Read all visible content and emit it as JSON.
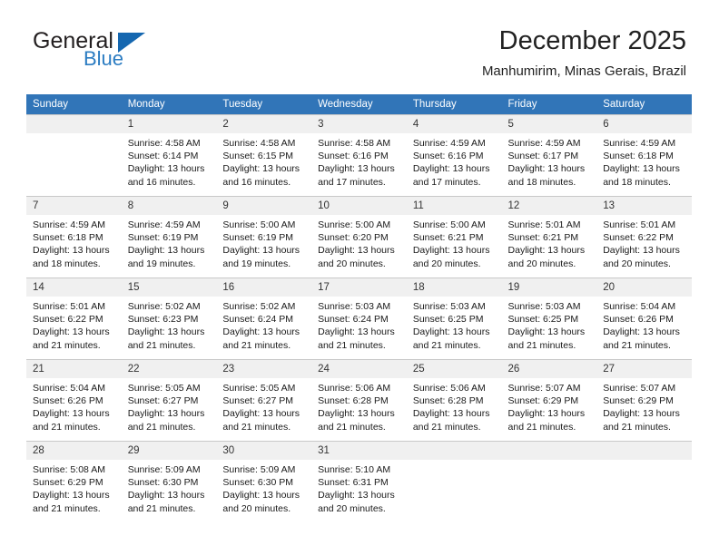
{
  "brand": {
    "name_part1": "General",
    "name_part2": "Blue",
    "triangle_color": "#1567b0",
    "blue_text_color": "#2b7cc2"
  },
  "header": {
    "title": "December 2025",
    "location": "Manhumirim, Minas Gerais, Brazil"
  },
  "calendar": {
    "header_bg": "#3175b8",
    "daynum_bg": "#f0f0f0",
    "weekdays": [
      "Sunday",
      "Monday",
      "Tuesday",
      "Wednesday",
      "Thursday",
      "Friday",
      "Saturday"
    ],
    "weeks": [
      [
        {
          "day": "",
          "sunrise": "",
          "sunset": "",
          "daylight_line1": "",
          "daylight_line2": "",
          "empty": true
        },
        {
          "day": "1",
          "sunrise": "Sunrise: 4:58 AM",
          "sunset": "Sunset: 6:14 PM",
          "daylight_line1": "Daylight: 13 hours",
          "daylight_line2": "and 16 minutes."
        },
        {
          "day": "2",
          "sunrise": "Sunrise: 4:58 AM",
          "sunset": "Sunset: 6:15 PM",
          "daylight_line1": "Daylight: 13 hours",
          "daylight_line2": "and 16 minutes."
        },
        {
          "day": "3",
          "sunrise": "Sunrise: 4:58 AM",
          "sunset": "Sunset: 6:16 PM",
          "daylight_line1": "Daylight: 13 hours",
          "daylight_line2": "and 17 minutes."
        },
        {
          "day": "4",
          "sunrise": "Sunrise: 4:59 AM",
          "sunset": "Sunset: 6:16 PM",
          "daylight_line1": "Daylight: 13 hours",
          "daylight_line2": "and 17 minutes."
        },
        {
          "day": "5",
          "sunrise": "Sunrise: 4:59 AM",
          "sunset": "Sunset: 6:17 PM",
          "daylight_line1": "Daylight: 13 hours",
          "daylight_line2": "and 18 minutes."
        },
        {
          "day": "6",
          "sunrise": "Sunrise: 4:59 AM",
          "sunset": "Sunset: 6:18 PM",
          "daylight_line1": "Daylight: 13 hours",
          "daylight_line2": "and 18 minutes."
        }
      ],
      [
        {
          "day": "7",
          "sunrise": "Sunrise: 4:59 AM",
          "sunset": "Sunset: 6:18 PM",
          "daylight_line1": "Daylight: 13 hours",
          "daylight_line2": "and 18 minutes."
        },
        {
          "day": "8",
          "sunrise": "Sunrise: 4:59 AM",
          "sunset": "Sunset: 6:19 PM",
          "daylight_line1": "Daylight: 13 hours",
          "daylight_line2": "and 19 minutes."
        },
        {
          "day": "9",
          "sunrise": "Sunrise: 5:00 AM",
          "sunset": "Sunset: 6:19 PM",
          "daylight_line1": "Daylight: 13 hours",
          "daylight_line2": "and 19 minutes."
        },
        {
          "day": "10",
          "sunrise": "Sunrise: 5:00 AM",
          "sunset": "Sunset: 6:20 PM",
          "daylight_line1": "Daylight: 13 hours",
          "daylight_line2": "and 20 minutes."
        },
        {
          "day": "11",
          "sunrise": "Sunrise: 5:00 AM",
          "sunset": "Sunset: 6:21 PM",
          "daylight_line1": "Daylight: 13 hours",
          "daylight_line2": "and 20 minutes."
        },
        {
          "day": "12",
          "sunrise": "Sunrise: 5:01 AM",
          "sunset": "Sunset: 6:21 PM",
          "daylight_line1": "Daylight: 13 hours",
          "daylight_line2": "and 20 minutes."
        },
        {
          "day": "13",
          "sunrise": "Sunrise: 5:01 AM",
          "sunset": "Sunset: 6:22 PM",
          "daylight_line1": "Daylight: 13 hours",
          "daylight_line2": "and 20 minutes."
        }
      ],
      [
        {
          "day": "14",
          "sunrise": "Sunrise: 5:01 AM",
          "sunset": "Sunset: 6:22 PM",
          "daylight_line1": "Daylight: 13 hours",
          "daylight_line2": "and 21 minutes."
        },
        {
          "day": "15",
          "sunrise": "Sunrise: 5:02 AM",
          "sunset": "Sunset: 6:23 PM",
          "daylight_line1": "Daylight: 13 hours",
          "daylight_line2": "and 21 minutes."
        },
        {
          "day": "16",
          "sunrise": "Sunrise: 5:02 AM",
          "sunset": "Sunset: 6:24 PM",
          "daylight_line1": "Daylight: 13 hours",
          "daylight_line2": "and 21 minutes."
        },
        {
          "day": "17",
          "sunrise": "Sunrise: 5:03 AM",
          "sunset": "Sunset: 6:24 PM",
          "daylight_line1": "Daylight: 13 hours",
          "daylight_line2": "and 21 minutes."
        },
        {
          "day": "18",
          "sunrise": "Sunrise: 5:03 AM",
          "sunset": "Sunset: 6:25 PM",
          "daylight_line1": "Daylight: 13 hours",
          "daylight_line2": "and 21 minutes."
        },
        {
          "day": "19",
          "sunrise": "Sunrise: 5:03 AM",
          "sunset": "Sunset: 6:25 PM",
          "daylight_line1": "Daylight: 13 hours",
          "daylight_line2": "and 21 minutes."
        },
        {
          "day": "20",
          "sunrise": "Sunrise: 5:04 AM",
          "sunset": "Sunset: 6:26 PM",
          "daylight_line1": "Daylight: 13 hours",
          "daylight_line2": "and 21 minutes."
        }
      ],
      [
        {
          "day": "21",
          "sunrise": "Sunrise: 5:04 AM",
          "sunset": "Sunset: 6:26 PM",
          "daylight_line1": "Daylight: 13 hours",
          "daylight_line2": "and 21 minutes."
        },
        {
          "day": "22",
          "sunrise": "Sunrise: 5:05 AM",
          "sunset": "Sunset: 6:27 PM",
          "daylight_line1": "Daylight: 13 hours",
          "daylight_line2": "and 21 minutes."
        },
        {
          "day": "23",
          "sunrise": "Sunrise: 5:05 AM",
          "sunset": "Sunset: 6:27 PM",
          "daylight_line1": "Daylight: 13 hours",
          "daylight_line2": "and 21 minutes."
        },
        {
          "day": "24",
          "sunrise": "Sunrise: 5:06 AM",
          "sunset": "Sunset: 6:28 PM",
          "daylight_line1": "Daylight: 13 hours",
          "daylight_line2": "and 21 minutes."
        },
        {
          "day": "25",
          "sunrise": "Sunrise: 5:06 AM",
          "sunset": "Sunset: 6:28 PM",
          "daylight_line1": "Daylight: 13 hours",
          "daylight_line2": "and 21 minutes."
        },
        {
          "day": "26",
          "sunrise": "Sunrise: 5:07 AM",
          "sunset": "Sunset: 6:29 PM",
          "daylight_line1": "Daylight: 13 hours",
          "daylight_line2": "and 21 minutes."
        },
        {
          "day": "27",
          "sunrise": "Sunrise: 5:07 AM",
          "sunset": "Sunset: 6:29 PM",
          "daylight_line1": "Daylight: 13 hours",
          "daylight_line2": "and 21 minutes."
        }
      ],
      [
        {
          "day": "28",
          "sunrise": "Sunrise: 5:08 AM",
          "sunset": "Sunset: 6:29 PM",
          "daylight_line1": "Daylight: 13 hours",
          "daylight_line2": "and 21 minutes."
        },
        {
          "day": "29",
          "sunrise": "Sunrise: 5:09 AM",
          "sunset": "Sunset: 6:30 PM",
          "daylight_line1": "Daylight: 13 hours",
          "daylight_line2": "and 21 minutes."
        },
        {
          "day": "30",
          "sunrise": "Sunrise: 5:09 AM",
          "sunset": "Sunset: 6:30 PM",
          "daylight_line1": "Daylight: 13 hours",
          "daylight_line2": "and 20 minutes."
        },
        {
          "day": "31",
          "sunrise": "Sunrise: 5:10 AM",
          "sunset": "Sunset: 6:31 PM",
          "daylight_line1": "Daylight: 13 hours",
          "daylight_line2": "and 20 minutes."
        },
        {
          "day": "",
          "sunrise": "",
          "sunset": "",
          "daylight_line1": "",
          "daylight_line2": "",
          "empty": true
        },
        {
          "day": "",
          "sunrise": "",
          "sunset": "",
          "daylight_line1": "",
          "daylight_line2": "",
          "empty": true
        },
        {
          "day": "",
          "sunrise": "",
          "sunset": "",
          "daylight_line1": "",
          "daylight_line2": "",
          "empty": true
        }
      ]
    ]
  }
}
